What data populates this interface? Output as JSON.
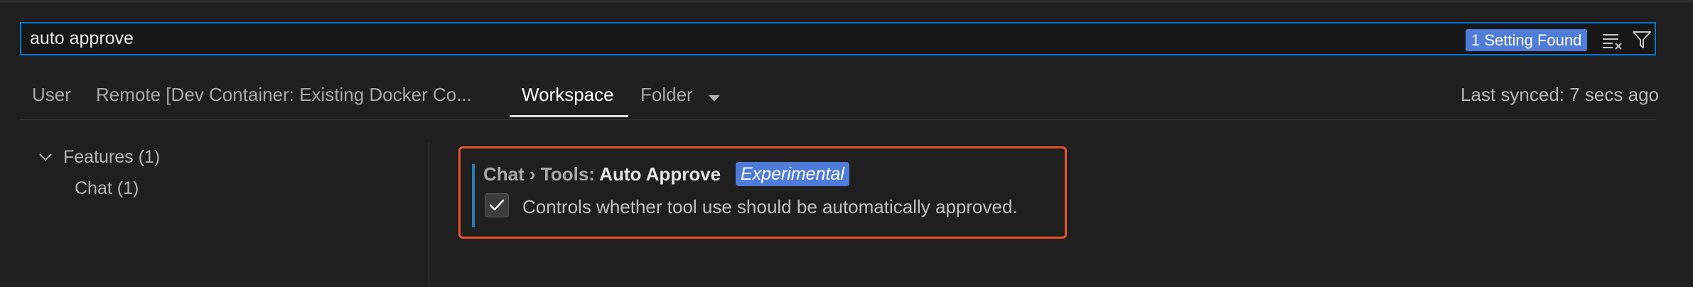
{
  "search": {
    "value": "auto approve",
    "result_badge": "1 Setting Found"
  },
  "tabs": [
    {
      "label": "User"
    },
    {
      "label": "Remote [Dev Container: Existing Docker Co..."
    },
    {
      "label": "Workspace",
      "active": true
    },
    {
      "label": "Folder"
    }
  ],
  "last_synced": "Last synced: 7 secs ago",
  "tree": {
    "features": "Features (1)",
    "chat": "Chat (1)"
  },
  "setting": {
    "category": "Chat › Tools: ",
    "name": "Auto Approve",
    "badge": "Experimental",
    "checked": true,
    "description": "Controls whether tool use should be automatically approved."
  },
  "colors": {
    "accent": "#0078d4",
    "badge": "#4f7bd9",
    "highlight_border": "#e8532f"
  },
  "icons": [
    "clear-filter-icon",
    "filter-icon",
    "chevron-down-icon",
    "check-icon"
  ]
}
